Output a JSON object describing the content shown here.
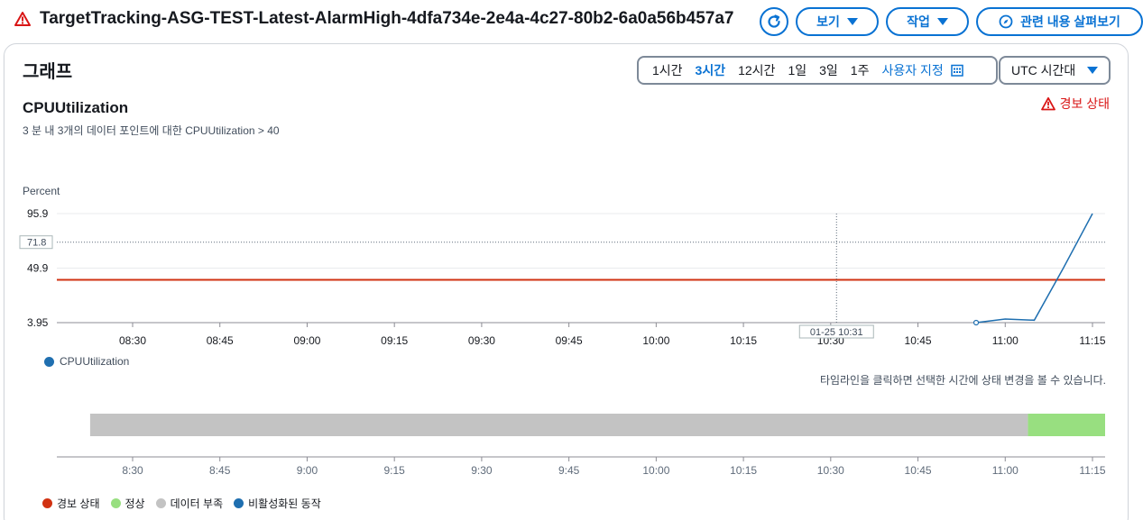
{
  "header": {
    "title": "TargetTracking-ASG-TEST-Latest-AlarmHigh-4dfa734e-2e4a-4c27-80b2-6a0a56b457a7",
    "view_label": "보기",
    "action_label": "작업",
    "explore_label": "관련 내용 살펴보기"
  },
  "card": {
    "title": "그래프",
    "ranges": [
      "1시간",
      "3시간",
      "12시간",
      "1일",
      "3일",
      "1주"
    ],
    "active_range": "3시간",
    "custom_label": "사용자 지정",
    "timezone": "UTC 시간대"
  },
  "metric": {
    "title": "CPUUtilization",
    "subtitle": "3 분 내 3개의 데이터 포인트에 대한 CPUUtilization > 40",
    "alarm_status": "경보 상태",
    "y_unit": "Percent",
    "legend": "CPUUtilization"
  },
  "chart_data": {
    "type": "line",
    "ylabel": "Percent",
    "ylim": [
      3.95,
      95.9
    ],
    "y_ticks": [
      "95.9",
      "49.9",
      "3.95"
    ],
    "y_tick_values": [
      95.9,
      49.9,
      3.95
    ],
    "crosshair_y_label": "71.8",
    "crosshair_y_value": 71.8,
    "crosshair_x_label": "01-25 10:31",
    "crosshair_x_minutes": 631,
    "threshold": 40,
    "x_ticks": [
      "08:30",
      "08:45",
      "09:00",
      "09:15",
      "09:30",
      "09:45",
      "10:00",
      "10:15",
      "10:30",
      "10:45",
      "11:00",
      "11:15"
    ],
    "x_tick_minutes": [
      510,
      525,
      540,
      555,
      570,
      585,
      600,
      615,
      630,
      645,
      660,
      675
    ],
    "series": [
      {
        "name": "CPUUtilization",
        "color": "#1f6fb0",
        "x_minutes": [
          655,
          660,
          665,
          670,
          675
        ],
        "values": [
          3.95,
          7,
          6,
          50,
          95.9
        ]
      }
    ]
  },
  "timeline": {
    "hint": "타임라인을 클릭하면 선택한 시간에 상태 변경을 볼 수 있습니다.",
    "x_ticks": [
      "8:30",
      "8:45",
      "9:00",
      "9:15",
      "9:30",
      "9:45",
      "10:00",
      "10:15",
      "10:30",
      "10:45",
      "11:00",
      "11:15"
    ],
    "segments": [
      {
        "state": "데이터 부족",
        "color": "#c3c3c3",
        "start_minutes": 502.7,
        "end_minutes": 663.9
      },
      {
        "state": "정상",
        "color": "#98df80",
        "start_minutes": 663.9,
        "end_minutes": 681.9
      },
      {
        "state": "경보 상태",
        "color": "#d91515",
        "start_minutes": 681.9,
        "end_minutes": 683
      }
    ],
    "legend": [
      {
        "label": "경보 상태",
        "color": "#d13212"
      },
      {
        "label": "정상",
        "color": "#98df80"
      },
      {
        "label": "데이터 부족",
        "color": "#c3c3c3"
      },
      {
        "label": "비활성화된 동작",
        "color": "#1f6fb0"
      }
    ]
  },
  "colors": {
    "accent": "#0972d3",
    "alarm": "#d91515",
    "threshold_line": "#d13212"
  }
}
